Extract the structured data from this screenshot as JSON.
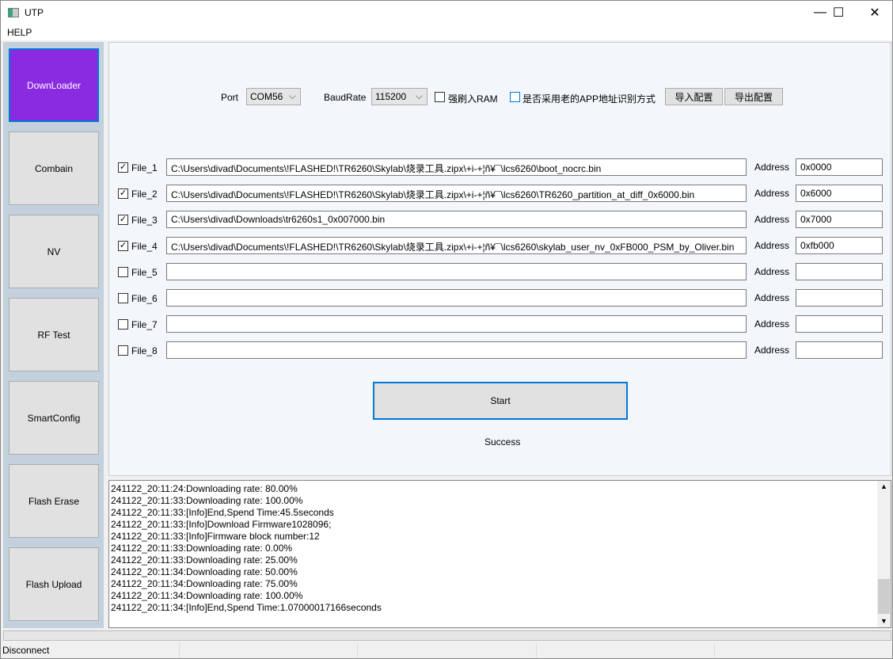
{
  "window": {
    "title": "UTP",
    "minimize": "—",
    "maximize": "☐",
    "close": "✕"
  },
  "menu": {
    "help": "HELP"
  },
  "sidebar": {
    "items": [
      {
        "label": "DownLoader",
        "active": true
      },
      {
        "label": "Combain"
      },
      {
        "label": "NV"
      },
      {
        "label": "RF Test"
      },
      {
        "label": "SmartConfig"
      },
      {
        "label": "Flash Erase"
      },
      {
        "label": "Flash Upload"
      }
    ]
  },
  "config": {
    "port_label": "Port",
    "port_value": "COM56",
    "baud_label": "BaudRate",
    "baud_value": "115200",
    "force_ram_label": "强刷入RAM",
    "force_ram_checked": false,
    "old_app_label": "是否采用老的APP地址识别方式",
    "old_app_checked": false,
    "import_label": "导入配置",
    "export_label": "导出配置"
  },
  "files": [
    {
      "label": "File_1",
      "checked": true,
      "path": "C:\\Users\\divad\\Documents\\!FLASHED!\\TR6260\\Skylab\\烧录工具.zipx\\+i-+¦ñ¥¯\\lcs6260\\boot_nocrc.bin",
      "address_label": "Address",
      "address": "0x0000"
    },
    {
      "label": "File_2",
      "checked": true,
      "path": "C:\\Users\\divad\\Documents\\!FLASHED!\\TR6260\\Skylab\\烧录工具.zipx\\+i-+¦ñ¥¯\\lcs6260\\TR6260_partition_at_diff_0x6000.bin",
      "address_label": "Address",
      "address": "0x6000"
    },
    {
      "label": "File_3",
      "checked": true,
      "path": "C:\\Users\\divad\\Downloads\\tr6260s1_0x007000.bin",
      "address_label": "Address",
      "address": "0x7000"
    },
    {
      "label": "File_4",
      "checked": true,
      "path": "C:\\Users\\divad\\Documents\\!FLASHED!\\TR6260\\Skylab\\烧录工具.zipx\\+i-+¦ñ¥¯\\lcs6260\\skylab_user_nv_0xFB000_PSM_by_Oliver.bin",
      "address_label": "Address",
      "address": "0xfb000"
    },
    {
      "label": "File_5",
      "checked": false,
      "path": "",
      "address_label": "Address",
      "address": ""
    },
    {
      "label": "File_6",
      "checked": false,
      "path": "",
      "address_label": "Address",
      "address": ""
    },
    {
      "label": "File_7",
      "checked": false,
      "path": "",
      "address_label": "Address",
      "address": ""
    },
    {
      "label": "File_8",
      "checked": false,
      "path": "",
      "address_label": "Address",
      "address": ""
    }
  ],
  "start_label": "Start",
  "result": "Success",
  "log": [
    "241122_20:11:24:Downloading rate: 80.00%",
    "241122_20:11:33:Downloading rate: 100.00%",
    "241122_20:11:33:[Info]End,Spend Time:45.5seconds",
    "241122_20:11:33:[Info]Download Firmware1028096;",
    "241122_20:11:33:[Info]Firmware block number:12",
    "241122_20:11:33:Downloading rate: 0.00%",
    "241122_20:11:33:Downloading rate: 25.00%",
    "241122_20:11:34:Downloading rate: 50.00%",
    "241122_20:11:34:Downloading rate: 75.00%",
    "241122_20:11:34:Downloading rate: 100.00%",
    "241122_20:11:34:[Info]End,Spend Time:1.07000017166seconds"
  ],
  "progress": 0,
  "status": {
    "connection": "Disconnect"
  },
  "colors": {
    "active": "#8a2be2",
    "focus": "#0078d7"
  }
}
